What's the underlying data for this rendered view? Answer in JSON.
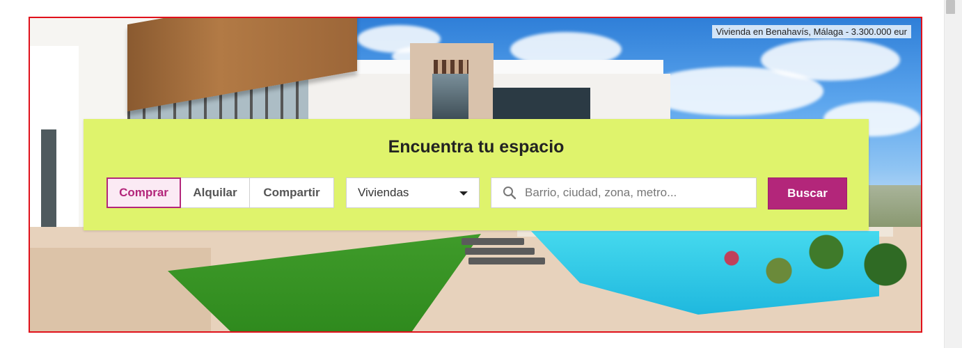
{
  "hero": {
    "caption": "Vivienda en Benahavís, Málaga - 3.300.000 eur"
  },
  "search_panel": {
    "title": "Encuentra tu espacio",
    "tabs": [
      {
        "label": "Comprar",
        "active": true
      },
      {
        "label": "Alquilar",
        "active": false
      },
      {
        "label": "Compartir",
        "active": false
      }
    ],
    "property_type": {
      "selected": "Viviendas"
    },
    "location": {
      "placeholder": "Barrio, ciudad, zona, metro..."
    },
    "search_button": "Buscar"
  },
  "colors": {
    "panel_background": "#dff36c",
    "accent": "#b3267a",
    "hero_border": "#e0101a"
  },
  "icons": {
    "location_search": "search-icon",
    "dropdown": "chevron-down-icon"
  }
}
